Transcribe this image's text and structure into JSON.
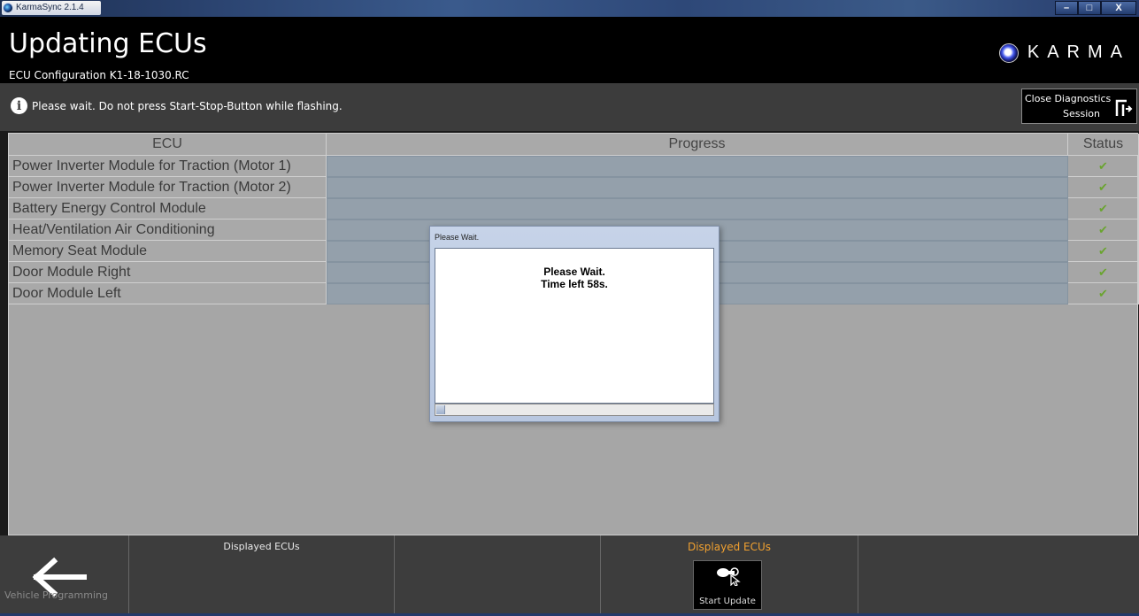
{
  "window": {
    "title": "KarmaSync 2.1.4",
    "minimize": "–",
    "maximize": "□",
    "close": "X"
  },
  "header": {
    "title": "Updating ECUs",
    "subtitle": "ECU Configuration K1-18-1030.RC",
    "brand": "KARMA"
  },
  "info": {
    "icon": "info-icon",
    "message": "Please wait. Do not press Start-Stop-Button while flashing."
  },
  "close_diagnostics": {
    "line1": "Close Diagnostics",
    "line2": "Session",
    "icon": "exit-door-icon"
  },
  "table": {
    "columns": [
      "ECU",
      "Progress",
      "Status"
    ],
    "rows": [
      {
        "ecu": "Power Inverter Module for Traction (Motor 1)",
        "status": "✔"
      },
      {
        "ecu": "Power Inverter Module for Traction (Motor 2)",
        "status": "✔"
      },
      {
        "ecu": "Battery Energy Control Module",
        "status": "✔"
      },
      {
        "ecu": "Heat/Ventilation Air Conditioning",
        "status": "✔"
      },
      {
        "ecu": "Memory Seat Module",
        "status": "✔"
      },
      {
        "ecu": "Door Module Right",
        "status": "✔"
      },
      {
        "ecu": "Door Module Left",
        "status": "✔"
      }
    ],
    "status_color": "#6aa42f"
  },
  "dialog": {
    "title": "Please Wait.",
    "line1": "Please Wait.",
    "line2": "Time left 58s.",
    "progress": 0.03
  },
  "footer": {
    "back_label": "Vehicle Programming",
    "back_icon": "arrow-left-icon",
    "displayed_ecus_1": "Displayed ECUs",
    "displayed_ecus_2": "Displayed ECUs",
    "start_update": "Start Update",
    "start_icon": "key-cursor-icon",
    "accent": "#f0a030"
  }
}
